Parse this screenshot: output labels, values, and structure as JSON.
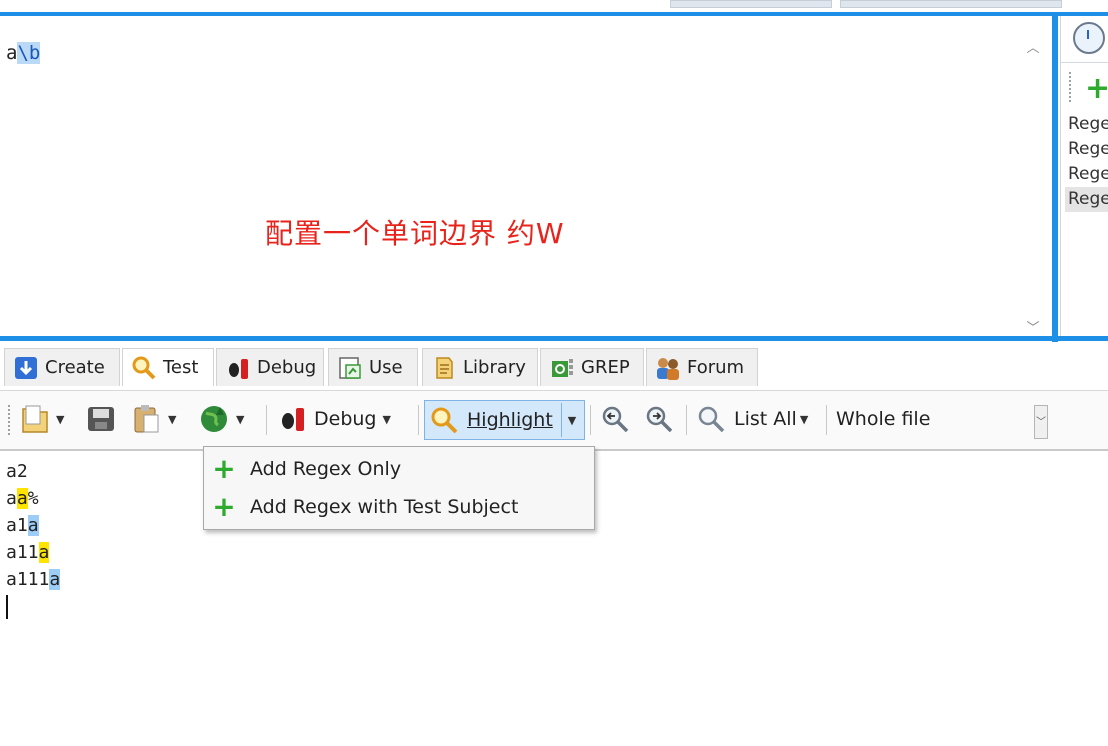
{
  "regex": {
    "plain": "a",
    "highlighted": "\\b"
  },
  "caption": "配置一个单词边界  约W",
  "side_panel": {
    "items": [
      "Rege",
      "Rege",
      "Rege",
      "Rege"
    ]
  },
  "tabs": [
    {
      "label": "Create"
    },
    {
      "label": "Test"
    },
    {
      "label": "Debug"
    },
    {
      "label": "Use"
    },
    {
      "label": "Library"
    },
    {
      "label": "GREP"
    },
    {
      "label": "Forum"
    }
  ],
  "toolbar": {
    "debug_label": "Debug",
    "highlight_label": "Highlight",
    "list_all_label": "List All",
    "scope_label": "Whole file"
  },
  "menu": {
    "item1": "Add Regex Only",
    "item2": "Add Regex with Test Subject"
  },
  "subject": {
    "line1": "a2",
    "line2_pre": "a",
    "line2_match": "a",
    "line2_post": "%",
    "line3_pre": "a1",
    "line3_match": "a",
    "line4_pre": "a11",
    "line4_match": "a",
    "line5_pre": "a111",
    "line5_match": "a"
  },
  "colors": {
    "accent": "#1e8fe6",
    "match_yellow": "#ffe400",
    "match_blue": "#9ccdf6",
    "caption_red": "#e8231b"
  }
}
